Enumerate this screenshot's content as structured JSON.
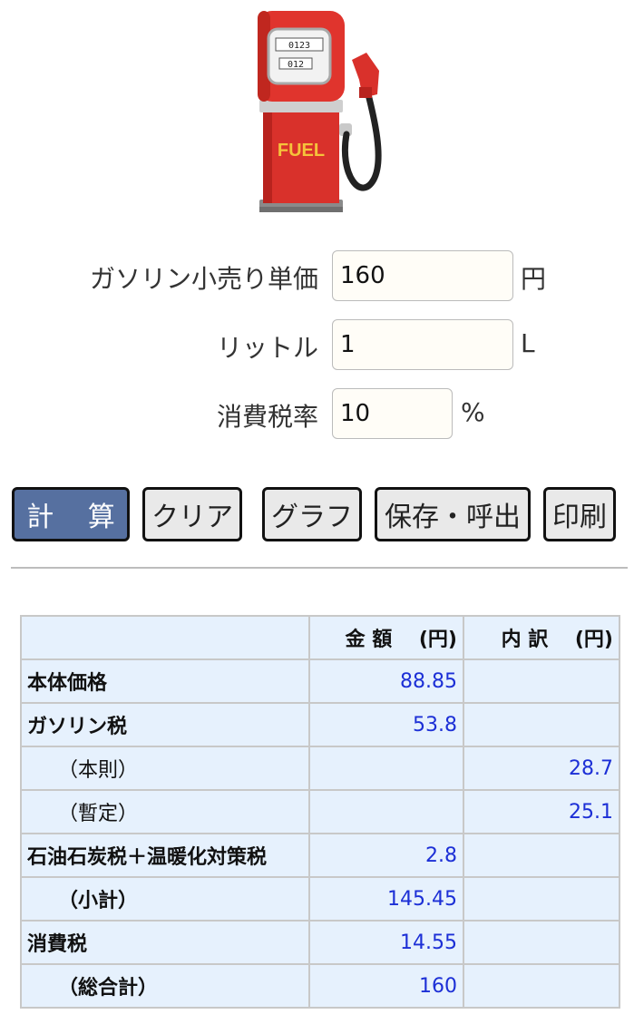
{
  "form": {
    "price_label": "ガソリン小売り単価",
    "price_value": "160",
    "price_unit": "円",
    "liter_label": "リットル",
    "liter_value": "1",
    "liter_unit": "L",
    "tax_label": "消費税率",
    "tax_value": "10",
    "tax_unit": "%"
  },
  "pump": {
    "label": "FUEL",
    "counter_top": "0123",
    "counter_bottom": "012"
  },
  "buttons": {
    "calc": "計 算",
    "clear": "クリア",
    "graph": "グラフ",
    "save": "保存・呼出",
    "print": "印刷"
  },
  "table": {
    "header_amount": "金 額　 (円)",
    "header_breakdown": "内 訳　 (円)",
    "rows": [
      {
        "label": "本体価格",
        "amount": "88.85",
        "breakdown": ""
      },
      {
        "label": "ガソリン税",
        "amount": "53.8",
        "breakdown": ""
      },
      {
        "label": "（本則）",
        "amount": "",
        "breakdown": "28.7"
      },
      {
        "label": "（暫定）",
        "amount": "",
        "breakdown": "25.1"
      },
      {
        "label": "石油石炭税＋温暖化対策税",
        "amount": "2.8",
        "breakdown": ""
      },
      {
        "label": "（小計）",
        "amount": "145.45",
        "breakdown": ""
      },
      {
        "label": "消費税",
        "amount": "14.55",
        "breakdown": ""
      },
      {
        "label": "（総合計）",
        "amount": "160",
        "breakdown": ""
      }
    ]
  }
}
